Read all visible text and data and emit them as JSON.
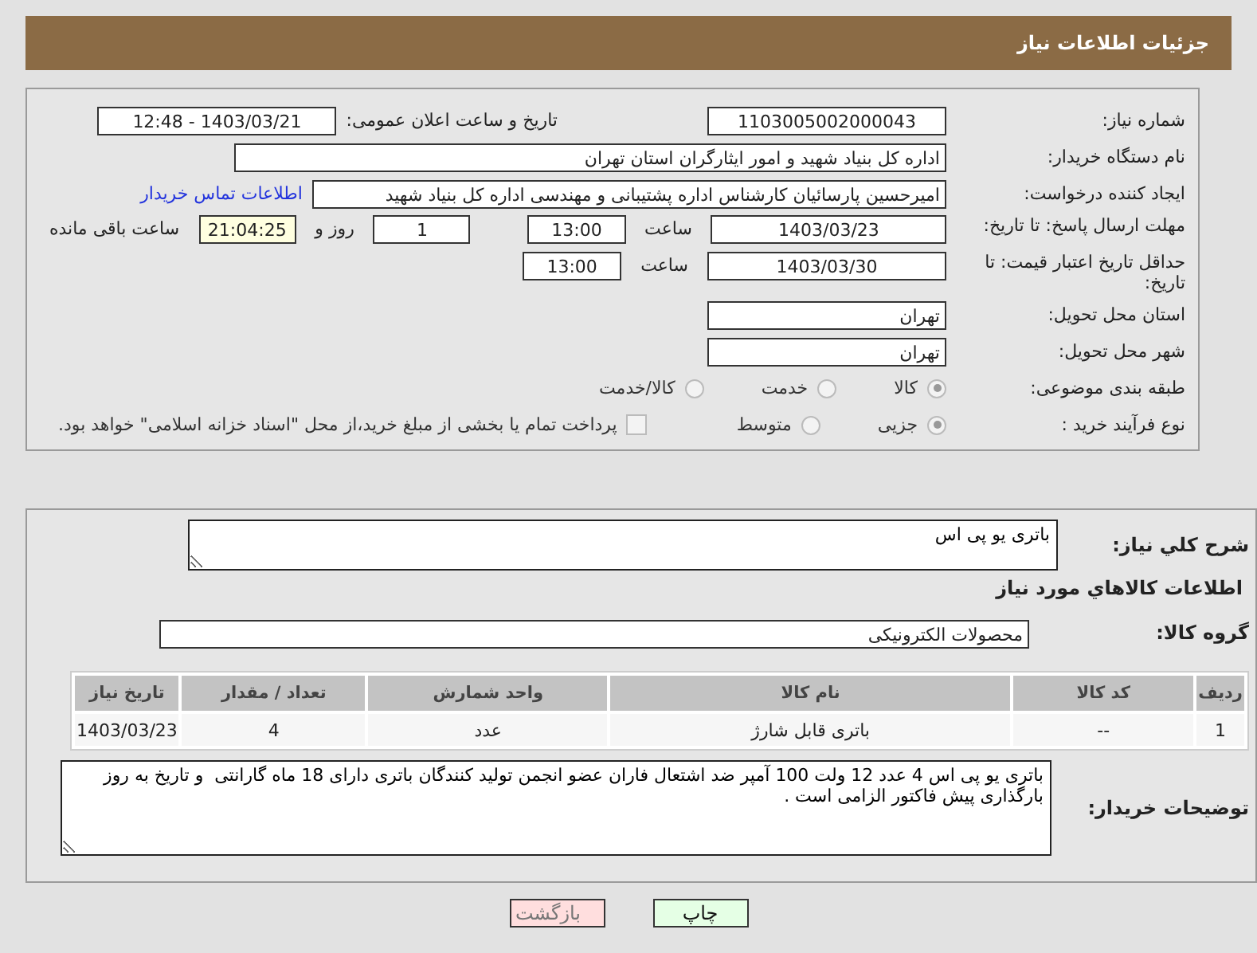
{
  "header": {
    "title": "جزئیات اطلاعات نیاز"
  },
  "need_number": {
    "label": "شماره نیاز:",
    "value": "1103005002000043"
  },
  "announce": {
    "label": "تاریخ و ساعت اعلان عمومی:",
    "value": "1403/03/21 - 12:48"
  },
  "buyer_org": {
    "label": "نام دستگاه خریدار:",
    "value": "اداره کل بنیاد شهید و امور ایثارگران استان تهران"
  },
  "creator": {
    "label": "ایجاد کننده درخواست:",
    "value": "امیرحسین پارسائیان کارشناس اداره پشتیبانی و مهندسی  اداره کل بنیاد شهید",
    "link": "اطلاعات تماس خریدار"
  },
  "deadline": {
    "label": "مهلت ارسال پاسخ: تا تاریخ:",
    "date": "1403/03/23",
    "time_label": "ساعت",
    "time": "13:00",
    "days": "1",
    "days_label": "روز و",
    "remaining": "21:04:25",
    "remaining_label": "ساعت باقی مانده"
  },
  "validity": {
    "label": "حداقل تاریخ اعتبار قیمت: تا تاریخ:",
    "date": "1403/03/30",
    "time_label": "ساعت",
    "time": "13:00"
  },
  "province": {
    "label": "استان محل تحویل:",
    "value": "تهران"
  },
  "city": {
    "label": "شهر محل تحویل:",
    "value": "تهران"
  },
  "category": {
    "label": "طبقه بندی موضوعی:",
    "options": [
      {
        "label": "کالا",
        "selected": true
      },
      {
        "label": "خدمت",
        "selected": false
      },
      {
        "label": "کالا/خدمت",
        "selected": false
      }
    ]
  },
  "process": {
    "label": "نوع فرآیند خرید :",
    "options": [
      {
        "label": "جزیی",
        "selected": true
      },
      {
        "label": "متوسط",
        "selected": false
      }
    ],
    "payment": {
      "label": "پرداخت تمام یا بخشی از مبلغ خرید،از محل \"اسناد خزانه اسلامی\" خواهد بود.",
      "checked": false
    }
  },
  "summary": {
    "label": "شرح کلي نياز:",
    "value": "باتری یو پی اس"
  },
  "goods_title": "اطلاعات كالاهاي مورد نياز",
  "goods_group": {
    "label": "گروه کالا:",
    "value": "محصولات الکترونیکی"
  },
  "table": {
    "columns": [
      "ردیف",
      "کد کالا",
      "نام کالا",
      "واحد شمارش",
      "تعداد / مقدار",
      "تاریخ نیاز"
    ],
    "rows": [
      [
        "1",
        "--",
        "باتری قابل شارژ",
        "عدد",
        "4",
        "1403/03/23"
      ]
    ]
  },
  "buyer_notes": {
    "label": "توضیحات خریدار:",
    "value": "باتری یو پی اس 4 عدد 12 ولت 100 آمپر ضد اشتعال فاران عضو انجمن تولید کنندگان باتری دارای 18 ماه گارانتی  و تاریخ به روز\nبارگذاری پیش فاکتور الزامی است ."
  },
  "buttons": [
    {
      "label": "چاپ",
      "kind": "print"
    },
    {
      "label": "بازگشت",
      "kind": "back"
    }
  ]
}
